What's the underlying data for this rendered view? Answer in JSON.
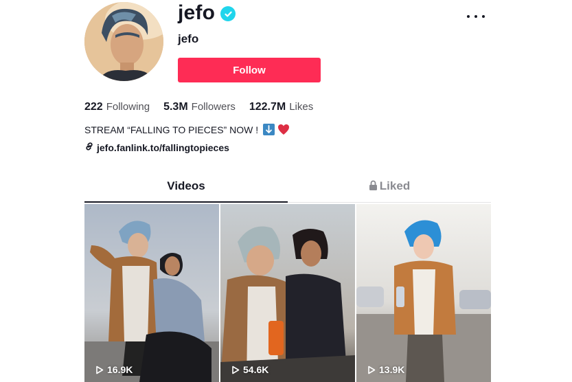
{
  "profile": {
    "username": "jefo",
    "nickname": "jefo",
    "verified": true,
    "follow_label": "Follow"
  },
  "stats": {
    "following_count": "222",
    "following_label": "Following",
    "followers_count": "5.3M",
    "followers_label": "Followers",
    "likes_count": "122.7M",
    "likes_label": "Likes"
  },
  "bio": {
    "text": "STREAM “FALLING TO PIECES” NOW !",
    "emojis": [
      "down-arrow-icon",
      "red-heart-icon"
    ]
  },
  "link": {
    "text": "jefo.fanlink.to/fallingtopieces",
    "icon": "link-icon"
  },
  "tabs": [
    {
      "label": "Videos",
      "active": true
    },
    {
      "label": "Liked",
      "active": false,
      "icon": "lock-icon"
    }
  ],
  "videos": [
    {
      "views": "16.9K"
    },
    {
      "views": "54.6K"
    },
    {
      "views": "13.9K"
    }
  ],
  "colors": {
    "accent": "#fe2c55",
    "verified": "#20d5ec",
    "text": "#161823",
    "muted": "#8a8b91"
  }
}
